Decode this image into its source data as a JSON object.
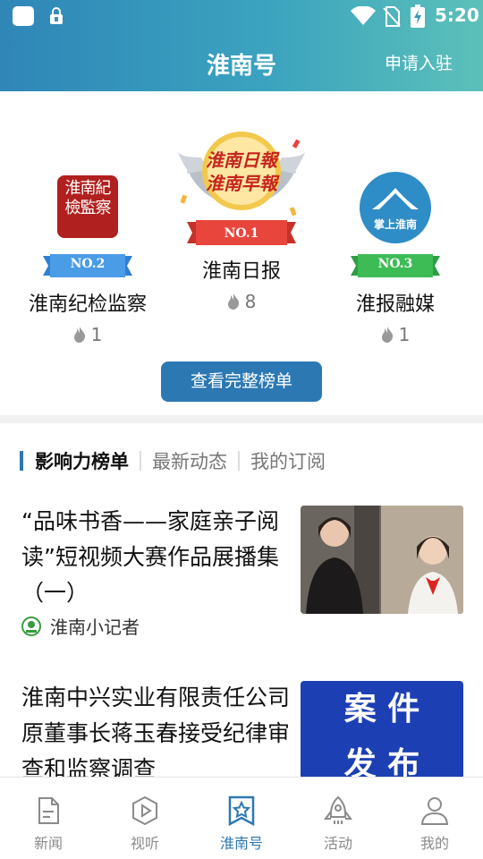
{
  "status_bar": {
    "time": "5:20",
    "icons": [
      "square-icon",
      "lock-icon",
      "wifi-icon",
      "no-sim-icon",
      "battery-charging-icon"
    ]
  },
  "header": {
    "title": "淮南号",
    "apply_label": "申请入驻"
  },
  "ranking": {
    "first": {
      "rank_label": "NO.1",
      "name": "淮南日报",
      "heat": "8",
      "logo_text_1": "淮南日報",
      "logo_text_2": "淮南早報"
    },
    "second": {
      "rank_label": "NO.2",
      "name": "淮南纪检监察",
      "heat": "1",
      "seal_text": "淮南紀檢監察"
    },
    "third": {
      "rank_label": "NO.3",
      "name": "淮报融媒",
      "heat": "1",
      "logo_text": "掌上淮南"
    },
    "view_all_label": "查看完整榜单"
  },
  "tabs": [
    {
      "label": "影响力榜单",
      "active": true
    },
    {
      "label": "最新动态",
      "active": false
    },
    {
      "label": "我的订阅",
      "active": false
    }
  ],
  "news": [
    {
      "title": "“品味书香——家庭亲子阅读”短视频大赛作品展播集（一）",
      "source": "淮南小记者"
    },
    {
      "title": "淮南中兴实业有限责任公司原董事长蒋玉春接受纪律审查和监察调查",
      "thumb_text_1": "案 件",
      "thumb_text_2": "发 布"
    }
  ],
  "colors": {
    "accent": "#2c78b3",
    "gold": "#e9b52d",
    "red_ribbon": "#e8453c",
    "blue_ribbon": "#4a9ce6",
    "green_ribbon": "#3dbb55"
  },
  "bottom_nav": [
    {
      "label": "新闻",
      "icon": "news-icon",
      "active": false
    },
    {
      "label": "视听",
      "icon": "play-icon",
      "active": false
    },
    {
      "label": "淮南号",
      "icon": "star-bookmark-icon",
      "active": true
    },
    {
      "label": "活动",
      "icon": "rocket-icon",
      "active": false
    },
    {
      "label": "我的",
      "icon": "user-icon",
      "active": false
    }
  ]
}
